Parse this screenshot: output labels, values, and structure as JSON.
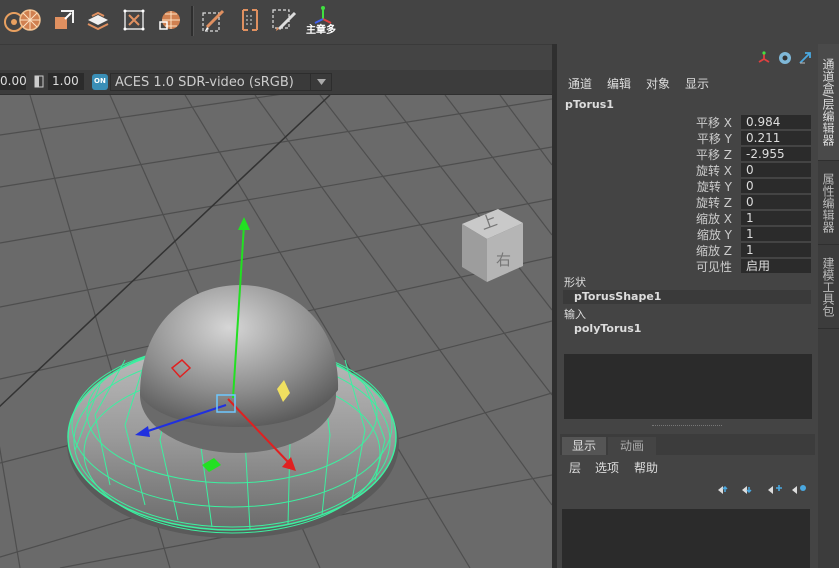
{
  "toolbar": {
    "icons": [
      "snap-target-icon",
      "soft-select-icon",
      "snap-surface-icon",
      "snap-layer-icon",
      "snap-frame-icon",
      "snap-grid-icon",
      "pen-edit-icon",
      "bracket-select-icon",
      "brush-select-icon",
      "manipulator-icon"
    ],
    "last_icon_caption": "主章多"
  },
  "viewport_bar": {
    "field_a": "0.00",
    "field_b": "1.00",
    "color_badge": "ON",
    "color_space": "ACES 1.0 SDR-video (sRGB)"
  },
  "view_cube": {
    "top": "上",
    "front": "右"
  },
  "channel_box": {
    "menu": [
      "通道",
      "编辑",
      "对象",
      "显示"
    ],
    "object_name": "pTorus1",
    "attributes": [
      {
        "label": "平移 X",
        "value": "0.984"
      },
      {
        "label": "平移 Y",
        "value": "0.211"
      },
      {
        "label": "平移 Z",
        "value": "-2.955"
      },
      {
        "label": "旋转 X",
        "value": "0"
      },
      {
        "label": "旋转 Y",
        "value": "0"
      },
      {
        "label": "旋转 Z",
        "value": "0"
      },
      {
        "label": "缩放 X",
        "value": "1"
      },
      {
        "label": "缩放 Y",
        "value": "1"
      },
      {
        "label": "缩放 Z",
        "value": "1"
      },
      {
        "label": "可见性",
        "value": "启用"
      }
    ],
    "shapes_label": "形状",
    "shape_node": "pTorusShape1",
    "inputs_label": "输入",
    "input_node": "polyTorus1"
  },
  "layer_editor": {
    "tabs": [
      "显示",
      "动画"
    ],
    "menu": [
      "层",
      "选项",
      "帮助"
    ]
  },
  "side_tabs": [
    "通道盒/层编辑器",
    "属性编辑器",
    "建模工具包"
  ],
  "colors": {
    "wireframe": "#3cf0a0",
    "axis_x": "#e02020",
    "axis_y": "#22e022",
    "axis_z": "#2030e0",
    "plane_yellow": "#f0e060",
    "selection": "#6ec8ff"
  }
}
